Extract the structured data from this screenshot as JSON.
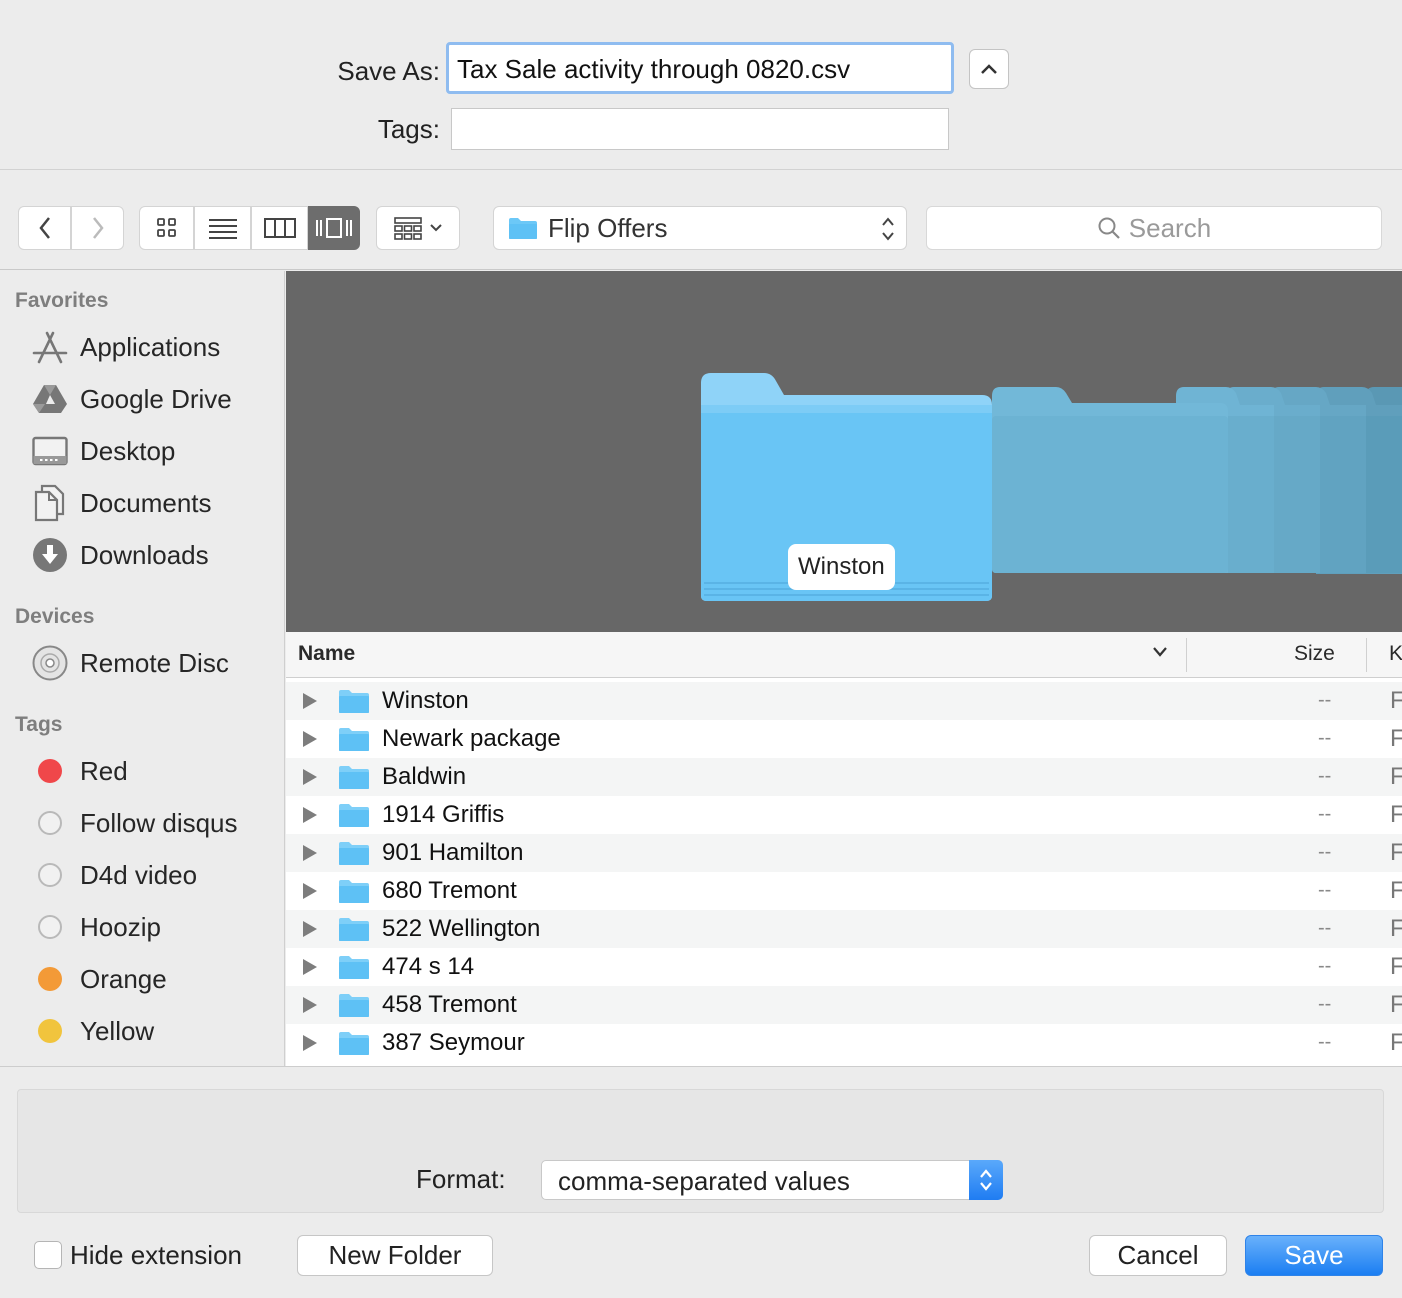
{
  "form": {
    "save_as_label": "Save As:",
    "save_as_value": "Tax Sale activity through 0820.csv",
    "tags_label": "Tags:",
    "tags_value": ""
  },
  "toolbar": {
    "location": "Flip Offers",
    "search_placeholder": "Search",
    "active_view": "cover-flow"
  },
  "sidebar": {
    "favorites_title": "Favorites",
    "favorites": [
      {
        "label": "Applications",
        "icon": "applications-icon"
      },
      {
        "label": "Google Drive",
        "icon": "google-drive-icon"
      },
      {
        "label": "Desktop",
        "icon": "desktop-icon"
      },
      {
        "label": "Documents",
        "icon": "documents-icon"
      },
      {
        "label": "Downloads",
        "icon": "downloads-icon"
      }
    ],
    "devices_title": "Devices",
    "devices": [
      {
        "label": "Remote Disc",
        "icon": "remote-disc-icon"
      }
    ],
    "tags_title": "Tags",
    "tags": [
      {
        "label": "Red",
        "color": "#f0474a",
        "filled": true
      },
      {
        "label": "Follow disqus",
        "color": "#f1f1f1",
        "filled": false
      },
      {
        "label": "D4d video",
        "color": "#f1f1f1",
        "filled": false
      },
      {
        "label": "Hoozip",
        "color": "#f1f1f1",
        "filled": false
      },
      {
        "label": "Orange",
        "color": "#f39a37",
        "filled": true
      },
      {
        "label": "Yellow",
        "color": "#f1c43d",
        "filled": true
      }
    ]
  },
  "coverflow": {
    "selected_caption": "Winston"
  },
  "list": {
    "columns": {
      "name": "Name",
      "size": "Size",
      "kind": "K"
    },
    "rows": [
      {
        "name": "Winston",
        "size": "--",
        "kind": "F"
      },
      {
        "name": "Newark package",
        "size": "--",
        "kind": "F"
      },
      {
        "name": "Baldwin",
        "size": "--",
        "kind": "F"
      },
      {
        "name": "1914 Griffis",
        "size": "--",
        "kind": "F"
      },
      {
        "name": "901 Hamilton",
        "size": "--",
        "kind": "F"
      },
      {
        "name": "680 Tremont",
        "size": "--",
        "kind": "F"
      },
      {
        "name": "522 Wellington",
        "size": "--",
        "kind": "F"
      },
      {
        "name": "474 s 14",
        "size": "--",
        "kind": "F"
      },
      {
        "name": "458 Tremont",
        "size": "--",
        "kind": "F"
      },
      {
        "name": "387 Seymour",
        "size": "--",
        "kind": "F"
      }
    ]
  },
  "bottom": {
    "format_label": "Format:",
    "format_value": "comma-separated values",
    "hide_extension_label": "Hide extension",
    "hide_extension_checked": false,
    "new_folder_label": "New Folder",
    "cancel_label": "Cancel",
    "save_label": "Save"
  },
  "colors": {
    "accent": "#1b7ef2",
    "folder": "#5ec1f5",
    "coverflow_bg": "#676767"
  }
}
